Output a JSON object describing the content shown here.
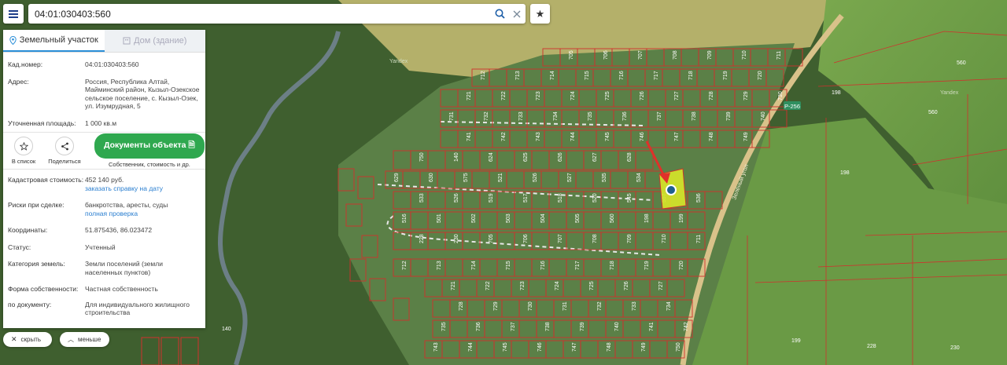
{
  "search": {
    "value": "04:01:030403:560"
  },
  "tabs": [
    {
      "label": "Земельный участок",
      "active": true
    },
    {
      "label": "Дом (здание)",
      "active": false
    }
  ],
  "info": {
    "cad_label": "Кад.номер:",
    "cad_value": "04:01:030403:560",
    "addr_label": "Адрес:",
    "addr_value": "Россия, Республика Алтай, Майминский район, Кызыл-Озекское сельское поселение, с. Кызыл-Озек, ул. Изумрудная, 5",
    "area_label": "Уточненная площадь:",
    "area_value": "1 000 кв.м"
  },
  "actions": {
    "list_label": "В список",
    "share_label": "Поделиться",
    "docs_button": "Документы объекта",
    "docs_sub": "Собственник, стоимость и др."
  },
  "details": {
    "cost_label": "Кадастровая стоимость:",
    "cost_value": "452 140 руб.",
    "cost_link": "заказать справку на дату",
    "risk_label": "Риски при сделке:",
    "risk_value": "банкротства, аресты, суды",
    "risk_link": "полная проверка",
    "coord_label": "Координаты:",
    "coord_value": "51.875436, 86.023472",
    "status_label": "Статус:",
    "status_value": "Учтенный",
    "cat_label": "Категория земель:",
    "cat_value": "Земли поселений (земли населенных пунктов)",
    "own_label": "Форма собственности:",
    "own_value": "Частная собственность",
    "doc_label": "по документу:",
    "doc_value": "Для индивидуального жилищного строительства"
  },
  "bottom": {
    "hide_label": "скрыть",
    "less_label": "меньше"
  },
  "map": {
    "road_label": "Р-256",
    "street_label": "Зелёный угол",
    "yandex_label": "Yandex",
    "parcels": [
      "575",
      "521",
      "526",
      "527",
      "535",
      "534",
      "533",
      "526",
      "519",
      "517",
      "518",
      "520",
      "545",
      "557",
      "536",
      "516",
      "501",
      "502",
      "503",
      "504",
      "505",
      "560",
      "198",
      "199",
      "228",
      "230",
      "705",
      "706",
      "707",
      "708",
      "709",
      "710",
      "711",
      "712",
      "713",
      "714",
      "715",
      "716",
      "717",
      "718",
      "719",
      "720",
      "721",
      "722",
      "723",
      "724",
      "725",
      "726",
      "727",
      "728",
      "729",
      "730",
      "731",
      "732",
      "733",
      "734",
      "735",
      "736",
      "737",
      "738",
      "739",
      "740",
      "741",
      "742",
      "743",
      "744",
      "745",
      "746",
      "747",
      "748",
      "749",
      "750",
      "140",
      "624",
      "625",
      "626",
      "627",
      "628",
      "629",
      "630"
    ]
  },
  "colors": {
    "accent": "#2fa84f",
    "link": "#2b7fd0",
    "parcel_line": "#d0312d",
    "selected_parcel": "#d8e62a"
  }
}
